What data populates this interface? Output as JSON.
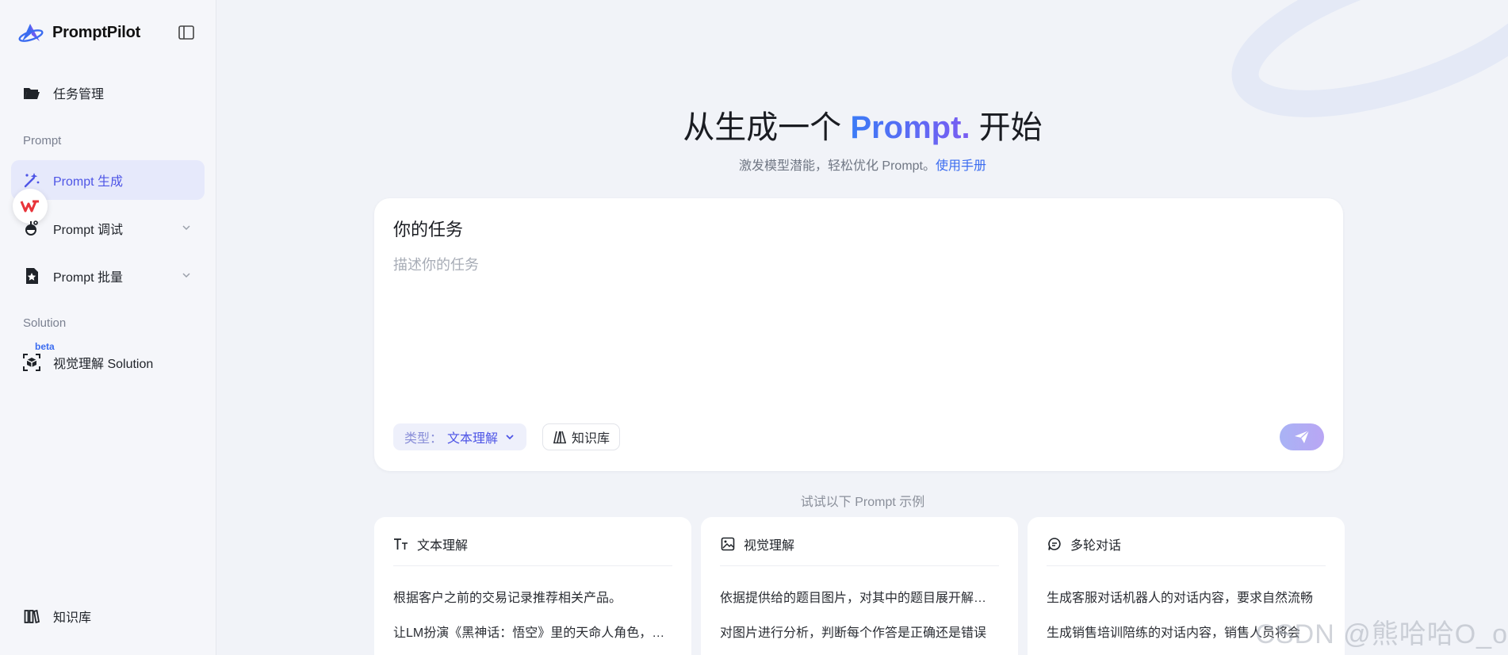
{
  "app": {
    "name": "PromptPilot"
  },
  "sidebar": {
    "task_mgmt": "任务管理",
    "section_prompt": "Prompt",
    "items": [
      {
        "label": "Prompt 生成"
      },
      {
        "label": "Prompt 调试"
      },
      {
        "label": "Prompt 批量"
      }
    ],
    "section_solution": "Solution",
    "beta": "beta",
    "vision_solution": "视觉理解 Solution",
    "knowledge_base": "知识库"
  },
  "hero": {
    "title_prefix": "从生成一个 ",
    "title_highlight": "Prompt.",
    "title_suffix": " 开始",
    "subtitle": "激发模型潜能，轻松优化 Prompt。",
    "manual_link": "使用手册"
  },
  "task": {
    "title": "你的任务",
    "placeholder": "描述你的任务",
    "type_label": "类型：",
    "type_value": "文本理解",
    "kb_button": "知识库"
  },
  "examples": {
    "label": "试试以下 Prompt 示例",
    "cards": [
      {
        "title": "文本理解",
        "lines": [
          "根据客户之前的交易记录推荐相关产品。",
          "让LM扮演《黑神话：悟空》里的天命人角色，与用户对话"
        ]
      },
      {
        "title": "视觉理解",
        "lines": [
          "依据提供给的题目图片，对其中的题目展开解答分析",
          "对图片进行分析，判断每个作答是正确还是错误"
        ]
      },
      {
        "title": "多轮对话",
        "lines": [
          "生成客服对话机器人的对话内容，要求自然流畅",
          "生成销售培训陪练的对话内容，销售人员将会"
        ]
      }
    ]
  },
  "watermark": "CSDN @熊哈哈O_o",
  "colors": {
    "accent": "#4e55e6",
    "link": "#3b6cf0",
    "active_bg": "#e6e9fb"
  }
}
